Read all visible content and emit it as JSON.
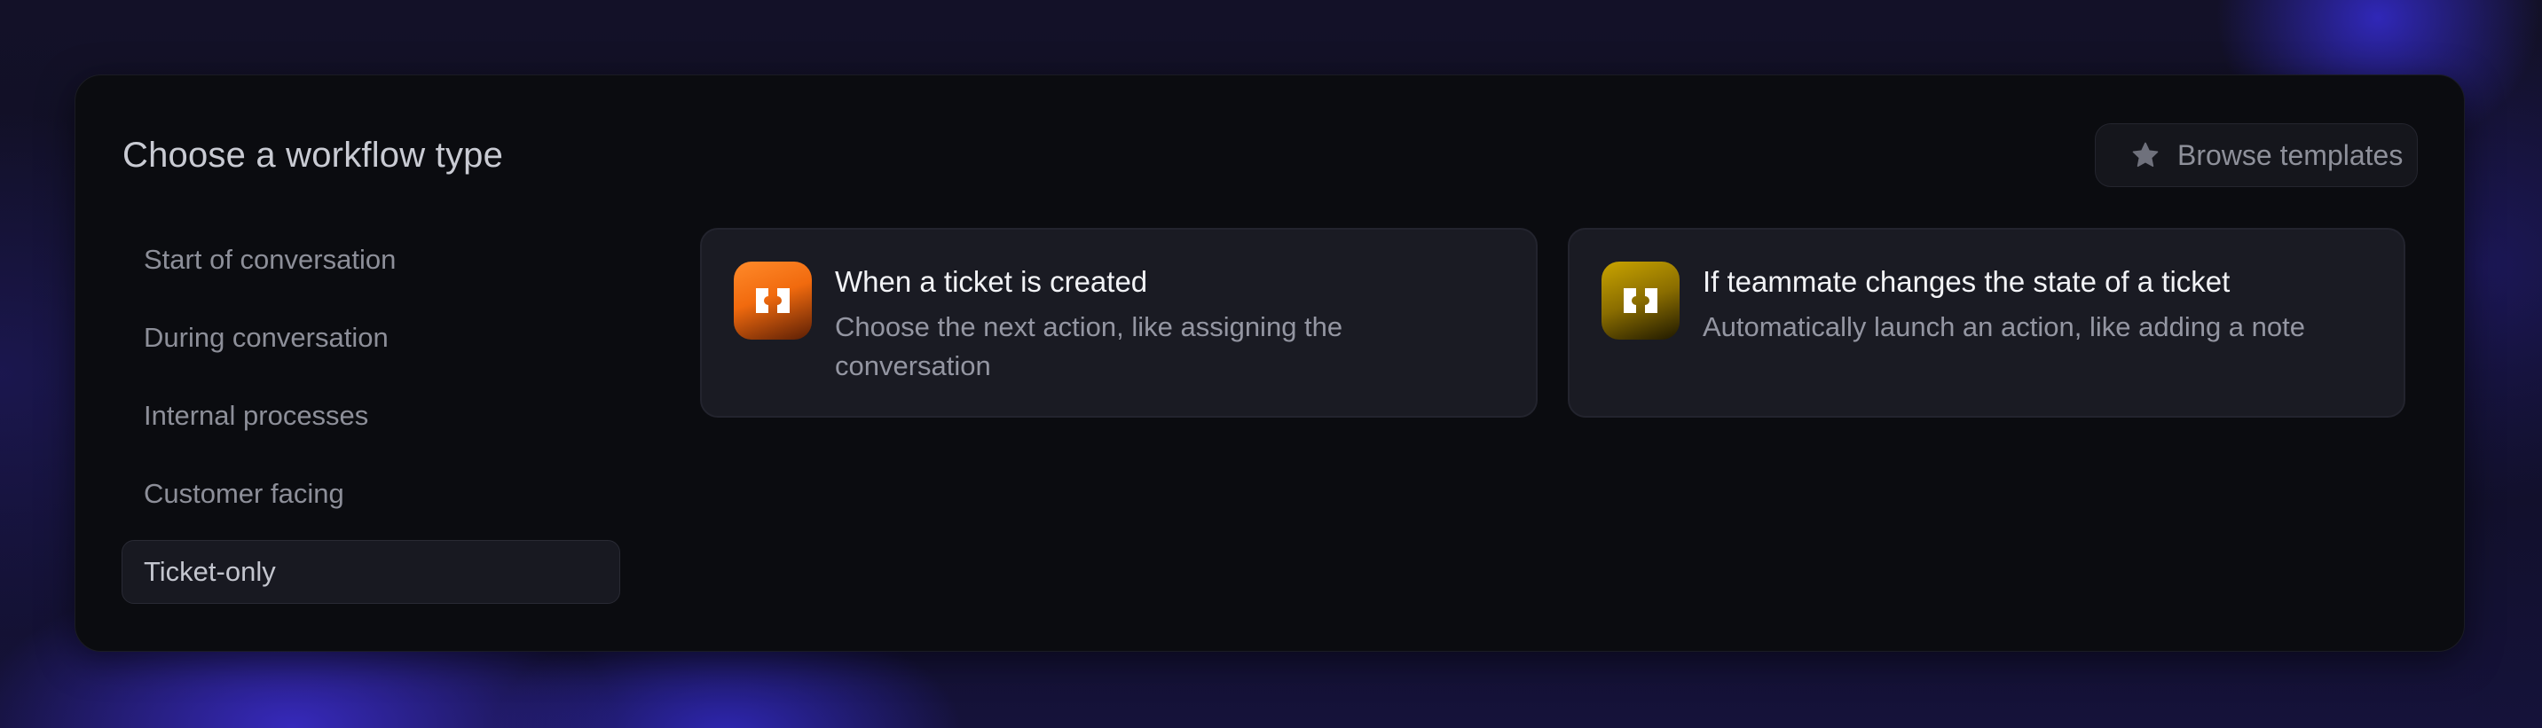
{
  "dialog": {
    "title": "Choose a workflow type",
    "browse_button": {
      "label": "Browse templates",
      "icon": "star-icon"
    }
  },
  "sidebar": {
    "items": [
      {
        "label": "Start of conversation",
        "active": false
      },
      {
        "label": "During conversation",
        "active": false
      },
      {
        "label": "Internal processes",
        "active": false
      },
      {
        "label": "Customer facing",
        "active": false
      },
      {
        "label": "Ticket-only",
        "active": true
      }
    ]
  },
  "cards": [
    {
      "title": "When a ticket is created",
      "description": "Choose the next action, like assigning the conversation",
      "icon": "ticket-icon",
      "accent": "#f16a0e"
    },
    {
      "title": "If teammate changes the state of a ticket",
      "description": "Automatically launch an action, like adding a note",
      "icon": "ticket-icon",
      "accent": "#b08c00"
    }
  ]
}
